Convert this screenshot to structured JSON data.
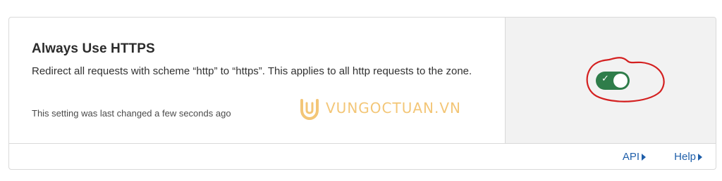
{
  "setting": {
    "title": "Always Use HTTPS",
    "description": "Redirect all requests with scheme “http” to “https”. This applies to all http requests to the zone.",
    "last_changed": "This setting was last changed a few seconds ago",
    "toggle_state": "on",
    "toggle_check": "✓"
  },
  "footer": {
    "api_label": "API",
    "help_label": "Help"
  },
  "watermark": {
    "text": "VUNGOCTUAN.VN"
  },
  "colors": {
    "toggle_on": "#2f7d4a",
    "link": "#1f5faa",
    "annotation": "#d42020",
    "watermark": "#f0b44a"
  }
}
